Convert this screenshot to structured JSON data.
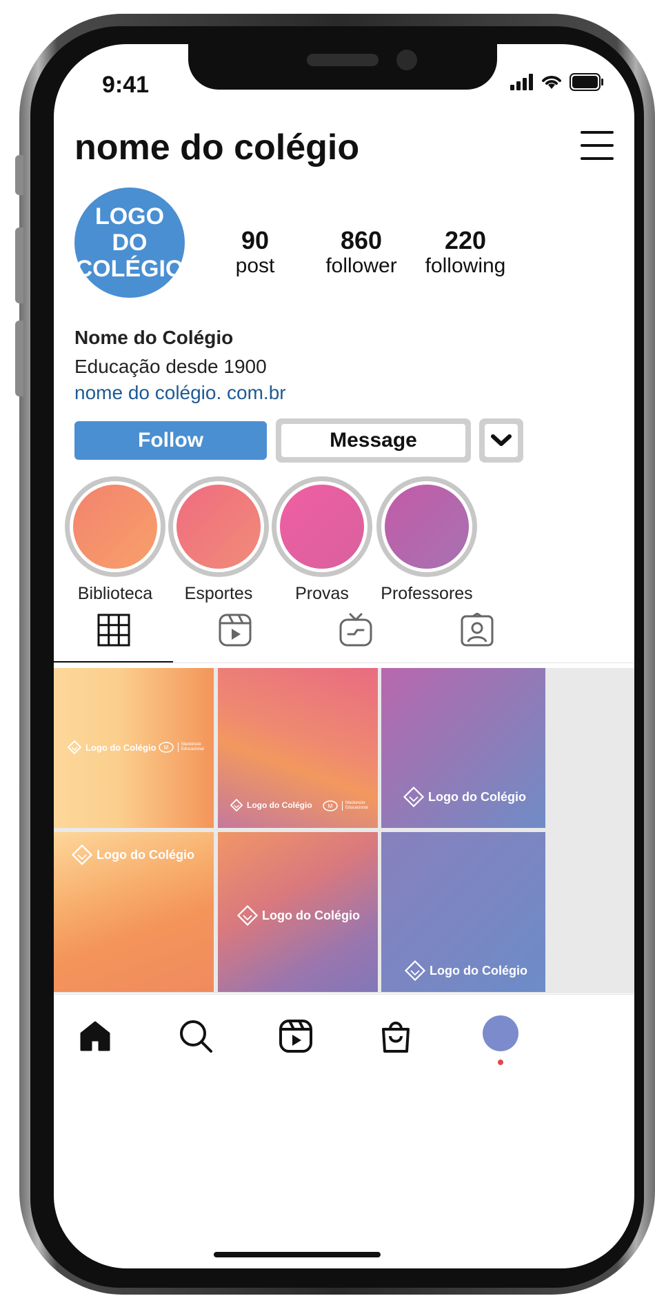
{
  "status_bar": {
    "time": "9:41",
    "icons": [
      "signal-icon",
      "wifi-icon",
      "battery-icon"
    ]
  },
  "header": {
    "title": "nome do colégio",
    "menu_icon": "hamburger-menu-icon"
  },
  "profile": {
    "avatar_text_line1": "LOGO DO",
    "avatar_text_line2": "COLÉGIO",
    "avatar_color": "#4a8fd1",
    "stats": [
      {
        "value": "90",
        "label": "post"
      },
      {
        "value": "860",
        "label": "follower"
      },
      {
        "value": "220",
        "label": "following"
      }
    ],
    "name": "Nome do Colégio",
    "description": "Educação desde 1900",
    "link": "nome do colégio. com.br"
  },
  "actions": {
    "follow_label": "Follow",
    "message_label": "Message",
    "more_icon": "chevron-down-icon",
    "follow_color": "#4a8fd1"
  },
  "highlights": [
    {
      "label": "Biblioteca",
      "color_a": "#f3836e",
      "color_b": "#f7a06a"
    },
    {
      "label": "Esportes",
      "color_a": "#f06c80",
      "color_b": "#f08c78"
    },
    {
      "label": "Provas",
      "color_a": "#f05fa2",
      "color_b": "#d8609e"
    },
    {
      "label": "Professores",
      "color_a": "#c45aa8",
      "color_b": "#a673b0"
    }
  ],
  "tabs": [
    {
      "name": "grid-tab",
      "icon": "grid-icon",
      "active": true
    },
    {
      "name": "reels-tab",
      "icon": "reels-icon",
      "active": false
    },
    {
      "name": "igtv-tab",
      "icon": "igtv-icon",
      "active": false
    },
    {
      "name": "tagged-tab",
      "icon": "tagged-user-icon",
      "active": false
    }
  ],
  "posts": {
    "logo_text": "Logo do Colégio",
    "partner_name": "Mackenzie",
    "partner_sub": "Educacional"
  },
  "bottom_nav": [
    {
      "name": "home",
      "icon": "home-icon"
    },
    {
      "name": "search",
      "icon": "search-icon"
    },
    {
      "name": "reels",
      "icon": "reels-icon"
    },
    {
      "name": "shop",
      "icon": "shopping-bag-icon"
    },
    {
      "name": "profile",
      "icon": "profile-avatar-icon"
    }
  ],
  "colors": {
    "link": "#1e5a94",
    "notification_dot": "#e0494d"
  }
}
